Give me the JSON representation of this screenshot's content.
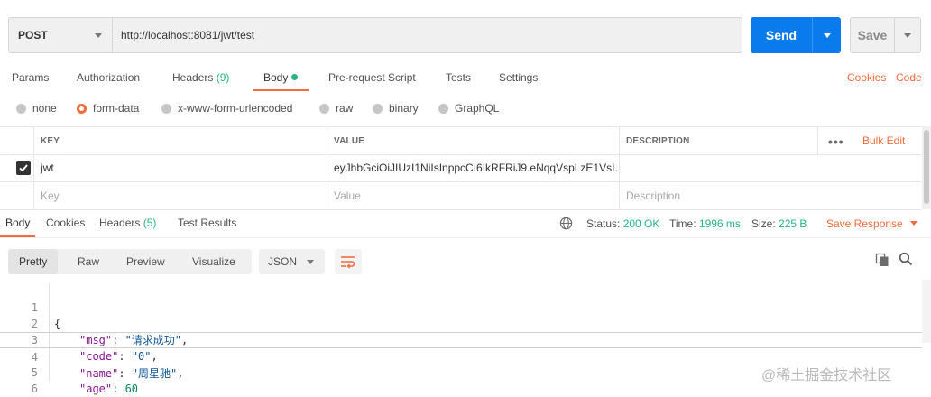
{
  "request": {
    "method": "POST",
    "url": "http://localhost:8081/jwt/test",
    "send_label": "Send",
    "save_label": "Save"
  },
  "request_tabs": [
    {
      "label": "Params"
    },
    {
      "label": "Authorization"
    },
    {
      "label": "Headers",
      "count": "(9)"
    },
    {
      "label": "Body",
      "active": true
    },
    {
      "label": "Pre-request Script"
    },
    {
      "label": "Tests"
    },
    {
      "label": "Settings"
    }
  ],
  "request_links": {
    "cookies": "Cookies",
    "code": "Code"
  },
  "body_types": [
    {
      "label": "none"
    },
    {
      "label": "form-data",
      "selected": true
    },
    {
      "label": "x-www-form-urlencoded"
    },
    {
      "label": "raw"
    },
    {
      "label": "binary"
    },
    {
      "label": "GraphQL"
    }
  ],
  "params_table": {
    "headers": {
      "key": "KEY",
      "value": "VALUE",
      "description": "DESCRIPTION"
    },
    "bulk_edit": "Bulk Edit",
    "rows": [
      {
        "checked": true,
        "key": "jwt",
        "value": "eyJhbGciOiJIUzI1NiIsInppcCI6IkRFRiJ9.eNqqVspLzE1VsI..."
      }
    ],
    "placeholders": {
      "key": "Key",
      "value": "Value",
      "description": "Description"
    }
  },
  "response_tabs": [
    {
      "label": "Body",
      "active": true
    },
    {
      "label": "Cookies"
    },
    {
      "label": "Headers",
      "count": "(5)"
    },
    {
      "label": "Test Results"
    }
  ],
  "response_meta": {
    "status_label": "Status:",
    "status_value": "200 OK",
    "time_label": "Time:",
    "time_value": "1996 ms",
    "size_label": "Size:",
    "size_value": "225 B",
    "save_response": "Save Response"
  },
  "view_modes": [
    {
      "label": "Pretty",
      "active": true
    },
    {
      "label": "Raw"
    },
    {
      "label": "Preview"
    },
    {
      "label": "Visualize"
    }
  ],
  "format": "JSON",
  "code_lines": [
    {
      "n": "1"
    },
    {
      "n": "2",
      "key": "\"msg\"",
      "val": "\"请求成功\"",
      "type": "s",
      "comma": ","
    },
    {
      "n": "3",
      "key": "\"code\"",
      "val": "\"0\"",
      "type": "s",
      "comma": ","
    },
    {
      "n": "4",
      "key": "\"name\"",
      "val": "\"周星驰\"",
      "type": "s",
      "comma": ","
    },
    {
      "n": "5",
      "key": "\"age\"",
      "val": "60",
      "type": "n",
      "comma": ""
    },
    {
      "n": "6"
    }
  ],
  "code_braces": {
    "open": "{",
    "close": "}"
  },
  "watermark": "@稀土掘金技术社区",
  "colors": {
    "accent": "#f26b3a",
    "send": "#097bed",
    "count": "#26b47f"
  },
  "icons": [
    "chevron-down-icon",
    "checkmark-icon",
    "more-dots-icon",
    "globe-icon",
    "wrap-lines-icon",
    "copy-icon",
    "search-icon"
  ]
}
